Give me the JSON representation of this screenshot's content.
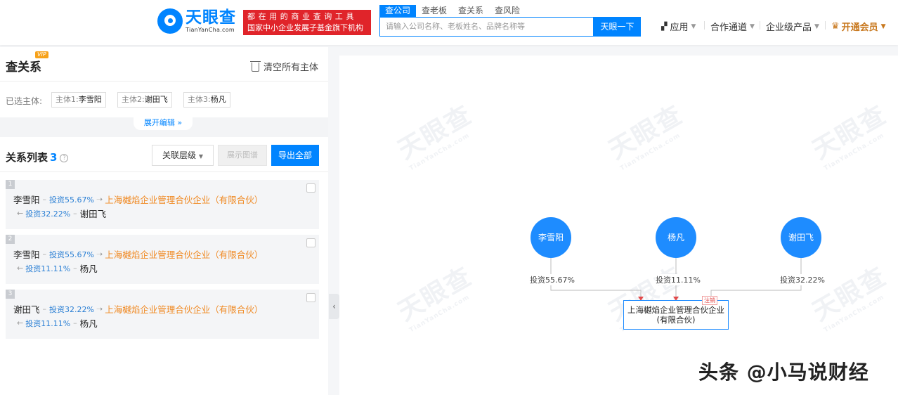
{
  "header": {
    "logo_cn": "天眼查",
    "logo_en": "TianYanCha.com",
    "slogan_line1": "都在用的商业查询工具",
    "slogan_line2": "国家中小企业发展子基金旗下机构",
    "search_tabs": [
      "查公司",
      "查老板",
      "查关系",
      "查风险"
    ],
    "search_placeholder": "请输入公司名称、老板姓名、品牌名称等",
    "search_button": "天眼一下",
    "nav": [
      "应用",
      "合作通道",
      "企业级产品",
      "开通会员"
    ]
  },
  "panel": {
    "title": "查关系",
    "vip": "VIP",
    "clear_all": "清空所有主体",
    "selected_label": "已选主体:",
    "chips": [
      {
        "prefix": "主体1:",
        "name": "李雪阳"
      },
      {
        "prefix": "主体2:",
        "name": "谢田飞"
      },
      {
        "prefix": "主体3:",
        "name": "杨凡"
      }
    ],
    "expand_edit": "展开编辑 »",
    "relations_title": "关系列表",
    "relations_count": "3",
    "level_button": "关联层级",
    "show_graph": "展示图谱",
    "export_all": "导出全部",
    "relations": [
      {
        "num": "1",
        "a": "李雪阳",
        "a_pct": "投资55.67%",
        "company": "上海樾焰企业管理合伙企业（有限合伙）",
        "b_pct": "投资32.22%",
        "b": "谢田飞"
      },
      {
        "num": "2",
        "a": "李雪阳",
        "a_pct": "投资55.67%",
        "company": "上海樾焰企业管理合伙企业（有限合伙）",
        "b_pct": "投资11.11%",
        "b": "杨凡"
      },
      {
        "num": "3",
        "a": "谢田飞",
        "a_pct": "投资32.22%",
        "company": "上海樾焰企业管理合伙企业（有限合伙）",
        "b_pct": "投资11.11%",
        "b": "杨凡"
      }
    ]
  },
  "graph": {
    "watermark": "天眼查",
    "watermark_en": "TianYanCha.com",
    "nodes": [
      "李雪阳",
      "杨凡",
      "谢田飞"
    ],
    "edge_labels": [
      "投资55.67%",
      "投资11.11%",
      "投资32.22%"
    ],
    "company_line1": "上海樾焰企业管理合伙企业",
    "company_line2": "(有限合伙)",
    "company_badge": "注销"
  },
  "colors": {
    "brand": "#0084ff",
    "slogan_bg": "#e0242a",
    "company_text": "#f08a24",
    "member": "#c8781e"
  },
  "watermark_signature": "头条 @小马说财经"
}
